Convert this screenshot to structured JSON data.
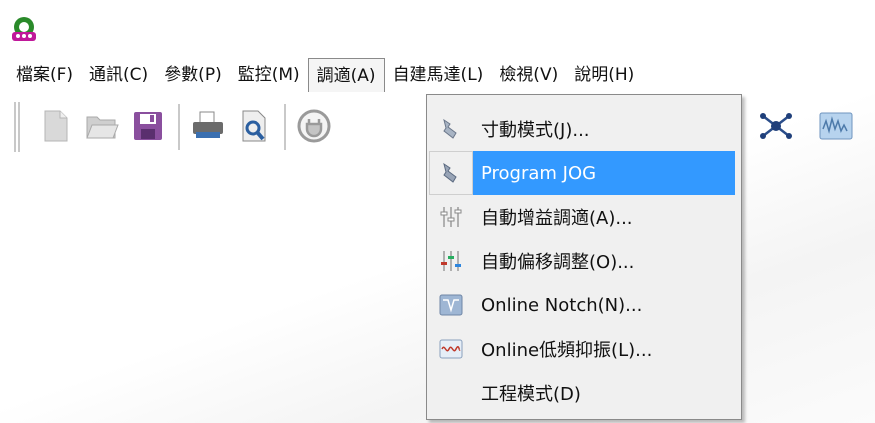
{
  "menubar": {
    "items": [
      {
        "label": "檔案(F)"
      },
      {
        "label": "通訊(C)"
      },
      {
        "label": "參數(P)"
      },
      {
        "label": "監控(M)"
      },
      {
        "label": "調適(A)",
        "active": true
      },
      {
        "label": "自建馬達(L)"
      },
      {
        "label": "檢視(V)"
      },
      {
        "label": "說明(H)"
      }
    ]
  },
  "toolbar": {
    "buttons": [
      {
        "icon": "new-file-icon"
      },
      {
        "icon": "open-folder-icon"
      },
      {
        "icon": "save-icon"
      },
      {
        "icon": "print-icon"
      },
      {
        "icon": "print-preview-icon"
      },
      {
        "icon": "connect-plug-icon"
      },
      {
        "icon": "network-icon"
      },
      {
        "icon": "scope-waveform-icon"
      }
    ]
  },
  "dropdown": {
    "items": [
      {
        "label": "寸動模式(J)...",
        "icon": "jog-hand-icon"
      },
      {
        "label": "Program JOG",
        "icon": "program-jog-icon",
        "highlighted": true
      },
      {
        "label": "自動增益調適(A)...",
        "icon": "auto-gain-sliders-icon"
      },
      {
        "label": "自動偏移調整(O)...",
        "icon": "auto-offset-sliders-icon"
      },
      {
        "label": "Online Notch(N)...",
        "icon": "notch-filter-icon"
      },
      {
        "label": "Online低頻抑振(L)...",
        "icon": "low-freq-vibration-icon"
      },
      {
        "label": "工程模式(D)"
      }
    ]
  },
  "colors": {
    "highlight": "#3399ff",
    "menu_bg": "#f0f0f0"
  }
}
